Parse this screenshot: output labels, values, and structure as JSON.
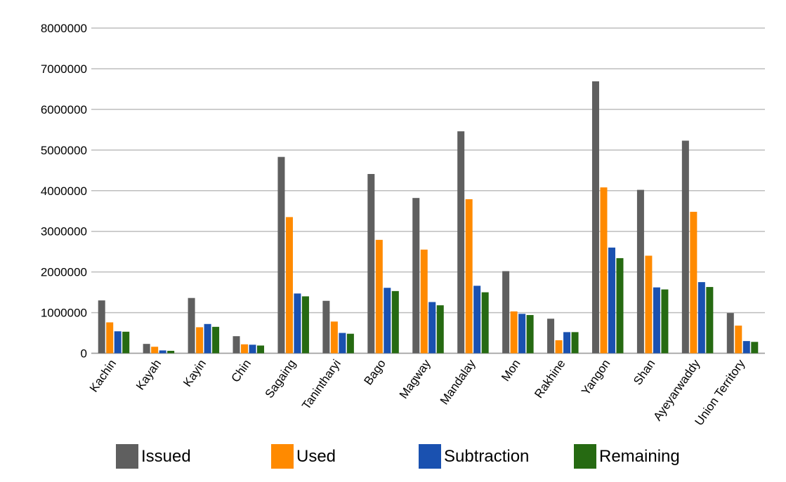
{
  "chart_data": {
    "type": "bar",
    "title": "",
    "xlabel": "",
    "ylabel": "",
    "ylim": [
      0,
      8000000
    ],
    "yticks": [
      0,
      1000000,
      2000000,
      3000000,
      4000000,
      5000000,
      6000000,
      7000000,
      8000000
    ],
    "ytick_labels": [
      "0",
      "1000000",
      "2000000",
      "3000000",
      "4000000",
      "5000000",
      "6000000",
      "7000000",
      "8000000"
    ],
    "grid": true,
    "legend_position": "bottom",
    "categories": [
      "Kachin",
      "Kayah",
      "Kayin",
      "Chin",
      "Sagaing",
      "Tanintharyi",
      "Bago",
      "Magway",
      "Mandalay",
      "Mon",
      "Rakhine",
      "Yangon",
      "Shan",
      "Ayeyarwaddy",
      "Union Territory"
    ],
    "series": [
      {
        "name": "Issued",
        "color": "#5f5f5f",
        "values": [
          1300000,
          230000,
          1360000,
          420000,
          4830000,
          1290000,
          4410000,
          3820000,
          5460000,
          2020000,
          850000,
          6690000,
          4020000,
          5230000,
          990000
        ]
      },
      {
        "name": "Used",
        "color": "#ff8a00",
        "values": [
          760000,
          160000,
          640000,
          220000,
          3350000,
          780000,
          2790000,
          2550000,
          3790000,
          1030000,
          320000,
          4080000,
          2400000,
          3480000,
          680000
        ]
      },
      {
        "name": "Subtraction",
        "color": "#1a51b0",
        "values": [
          540000,
          70000,
          720000,
          210000,
          1470000,
          500000,
          1610000,
          1260000,
          1660000,
          970000,
          520000,
          2600000,
          1620000,
          1750000,
          300000
        ]
      },
      {
        "name": "Remaining",
        "color": "#266a12",
        "values": [
          530000,
          60000,
          650000,
          190000,
          1400000,
          480000,
          1530000,
          1180000,
          1500000,
          940000,
          520000,
          2340000,
          1570000,
          1630000,
          280000
        ]
      }
    ]
  }
}
